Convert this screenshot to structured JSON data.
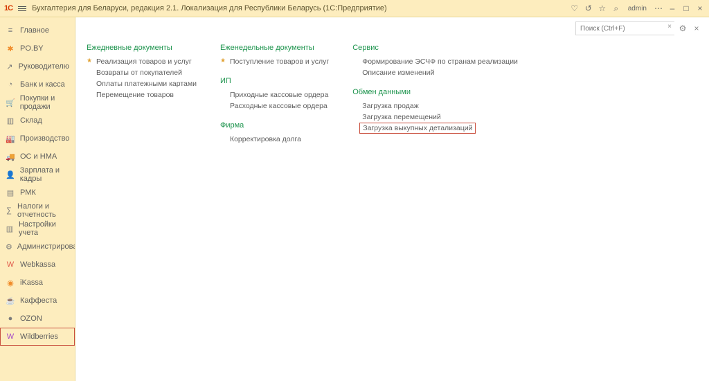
{
  "topbar": {
    "logo": "1C",
    "title": "Бухгалтерия для Беларуси, редакция 2.1. Локализация для Республики Беларусь  (1С:Предприятие)",
    "user": "admin"
  },
  "search": {
    "placeholder": "Поиск (Ctrl+F)"
  },
  "sidebar": [
    {
      "icon": "≡",
      "label": "Главное"
    },
    {
      "icon": "✱",
      "label": "PO.BY",
      "cls": "orange"
    },
    {
      "icon": "↗",
      "label": "Руководителю"
    },
    {
      "icon": "◔",
      "label": "Банк и касса"
    },
    {
      "icon": "🛒",
      "label": "Покупки и продажи"
    },
    {
      "icon": "▥",
      "label": "Склад"
    },
    {
      "icon": "🏭",
      "label": "Производство"
    },
    {
      "icon": "🚚",
      "label": "ОС и НМА"
    },
    {
      "icon": "👤",
      "label": "Зарплата и кадры"
    },
    {
      "icon": "▤",
      "label": "РМК"
    },
    {
      "icon": "∑",
      "label": "Налоги и отчетность"
    },
    {
      "icon": "▥",
      "label": "Настройки учета"
    },
    {
      "icon": "⚙",
      "label": "Администрирование"
    },
    {
      "icon": "W",
      "label": "Webkassa",
      "cls": "red"
    },
    {
      "icon": "◉",
      "label": "iKassa",
      "cls": "orange"
    },
    {
      "icon": "☕",
      "label": "Каффеста",
      "cls": "orange"
    },
    {
      "icon": "●",
      "label": "OZON"
    },
    {
      "icon": "W",
      "label": "Wildberries",
      "active": true
    }
  ],
  "sections": [
    {
      "heading": "Ежедневные документы",
      "items": [
        {
          "t": "Реализация товаров и услуг",
          "star": true
        },
        {
          "t": "Возвраты от покупателей"
        },
        {
          "t": "Оплаты платежными картами"
        },
        {
          "t": "Перемещение товаров"
        }
      ]
    },
    {
      "heading": "Еженедельные документы",
      "items": [
        {
          "t": "Поступление товаров и услуг",
          "star": true
        }
      ],
      "sub": [
        {
          "heading": "ИП",
          "items": [
            {
              "t": "Приходные кассовые ордера"
            },
            {
              "t": "Расходные кассовые ордера"
            }
          ]
        },
        {
          "heading": "Фирма",
          "items": [
            {
              "t": "Корректировка долга"
            }
          ]
        }
      ]
    },
    {
      "heading": "Сервис",
      "items": [
        {
          "t": "Формирование ЭСЧФ по странам реализации"
        },
        {
          "t": "Описание изменений"
        }
      ],
      "sub": [
        {
          "heading": "Обмен данными",
          "items": [
            {
              "t": "Загрузка продаж"
            },
            {
              "t": "Загрузка перемещений"
            },
            {
              "t": "Загрузка выкупных детализаций",
              "boxed": true
            }
          ]
        }
      ]
    }
  ]
}
